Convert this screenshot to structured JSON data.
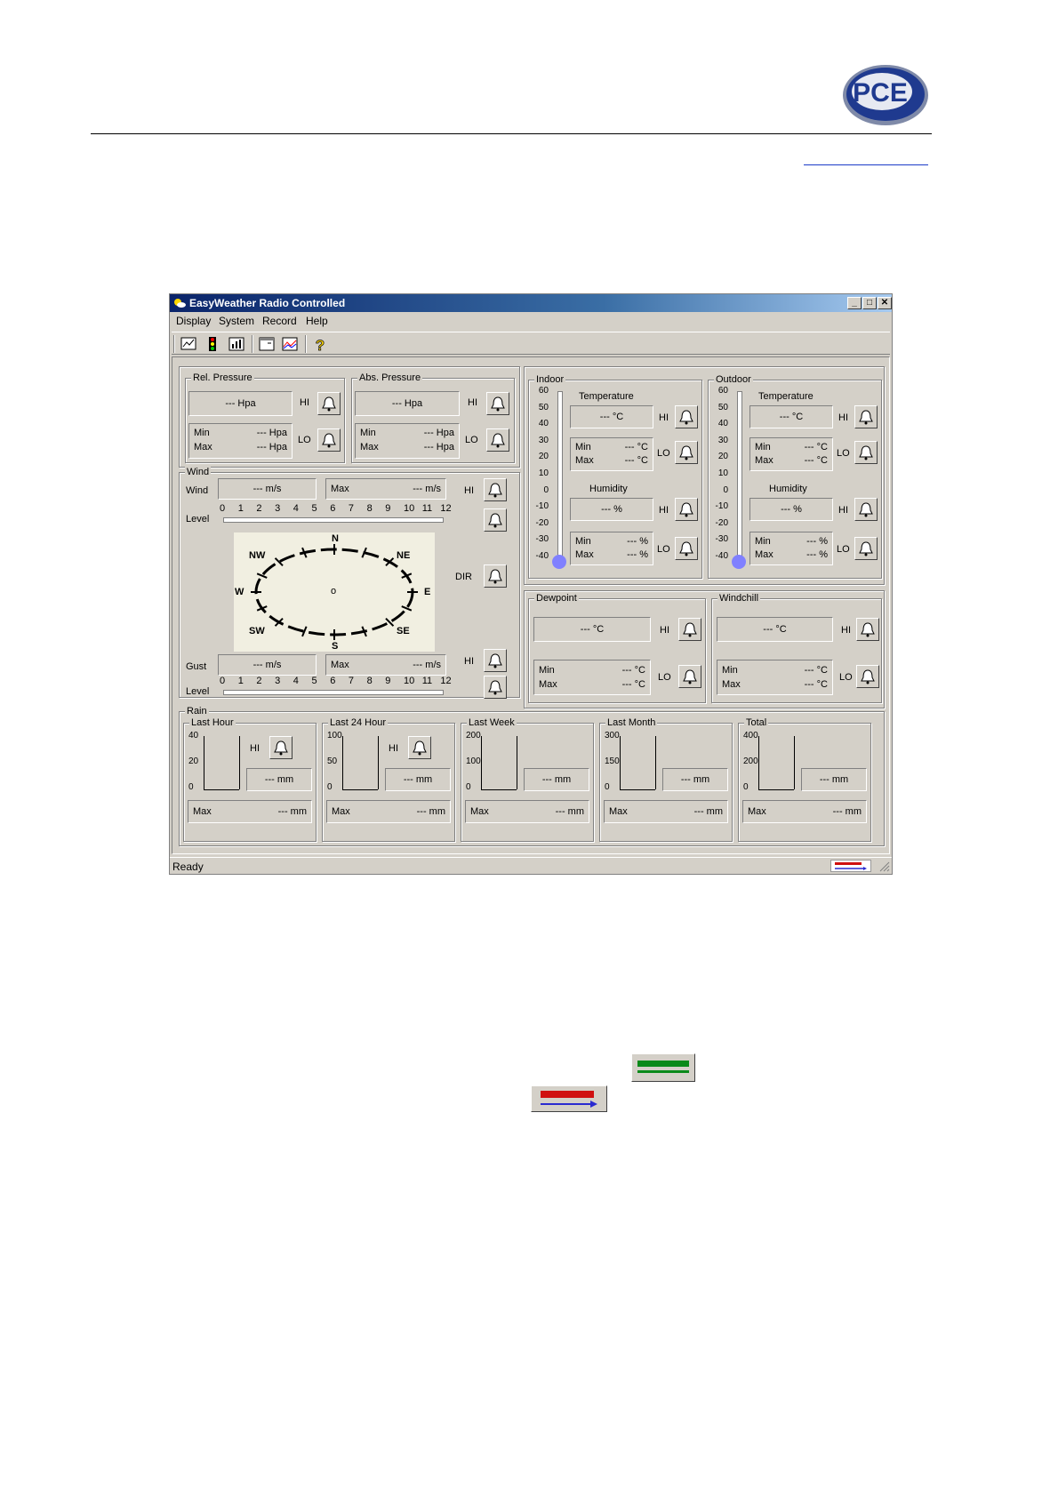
{
  "window": {
    "title": "EasyWeather Radio Controlled",
    "controls": [
      "_",
      "□",
      "✕"
    ]
  },
  "menu": [
    "Display",
    "System",
    "Record",
    "Help"
  ],
  "pressure": {
    "rel": {
      "title": "Rel. Pressure",
      "value": "--- Hpa",
      "hi": "HI",
      "lo": "LO",
      "min_label": "Min",
      "min": "--- Hpa",
      "max_label": "Max",
      "max": "--- Hpa"
    },
    "abs": {
      "title": "Abs. Pressure",
      "value": "--- Hpa",
      "hi": "HI",
      "lo": "LO",
      "min_label": "Min",
      "min": "--- Hpa",
      "max_label": "Max",
      "max": "--- Hpa"
    }
  },
  "wind": {
    "title": "Wind",
    "wind_label": "Wind",
    "wind_value": "--- m/s",
    "max_label": "Max",
    "max_value": "--- m/s",
    "hi": "HI",
    "level_label": "Level",
    "levels": [
      "0",
      "1",
      "2",
      "3",
      "4",
      "5",
      "6",
      "7",
      "8",
      "9",
      "10",
      "11",
      "12"
    ],
    "dir_label": "DIR",
    "compass": {
      "n": "N",
      "ne": "NE",
      "e": "E",
      "se": "SE",
      "s": "S",
      "sw": "SW",
      "w": "W",
      "nw": "NW",
      "center": "o"
    },
    "gust_label": "Gust",
    "gust_value": "--- m/s",
    "gust_max_label": "Max",
    "gust_max_value": "--- m/s",
    "gust_hi": "HI",
    "gust_level_label": "Level"
  },
  "thermo_scale": [
    "60",
    "50",
    "40",
    "30",
    "20",
    "10",
    "0",
    "-10",
    "-20",
    "-30",
    "-40"
  ],
  "indoor": {
    "title": "Indoor",
    "temp_label": "Temperature",
    "temp_value": "--- °C",
    "temp_hi": "HI",
    "temp_lo": "LO",
    "temp_min_label": "Min",
    "temp_min": "--- °C",
    "temp_max_label": "Max",
    "temp_max": "--- °C",
    "hum_label": "Humidity",
    "hum_value": "--- %",
    "hum_hi": "HI",
    "hum_lo": "LO",
    "hum_min_label": "Min",
    "hum_min": "--- %",
    "hum_max_label": "Max",
    "hum_max": "--- %"
  },
  "outdoor": {
    "title": "Outdoor",
    "temp_label": "Temperature",
    "temp_value": "--- °C",
    "temp_hi": "HI",
    "temp_lo": "LO",
    "temp_min_label": "Min",
    "temp_min": "--- °C",
    "temp_max_label": "Max",
    "temp_max": "--- °C",
    "hum_label": "Humidity",
    "hum_value": "--- %",
    "hum_hi": "HI",
    "hum_lo": "LO",
    "hum_min_label": "Min",
    "hum_min": "--- %",
    "hum_max_label": "Max",
    "hum_max": "--- %"
  },
  "dewpoint": {
    "title": "Dewpoint",
    "value": "--- °C",
    "hi": "HI",
    "lo": "LO",
    "min_label": "Min",
    "min": "--- °C",
    "max_label": "Max",
    "max": "--- °C"
  },
  "windchill": {
    "title": "Windchill",
    "value": "--- °C",
    "hi": "HI",
    "lo": "LO",
    "min_label": "Min",
    "min": "--- °C",
    "max_label": "Max",
    "max": "--- °C"
  },
  "rain": {
    "title": "Rain",
    "panels": [
      {
        "title": "Last Hour",
        "scale": [
          "40",
          "20",
          "0"
        ],
        "hi": "HI",
        "value": "--- mm",
        "max_label": "Max",
        "max": "--- mm"
      },
      {
        "title": "Last 24 Hour",
        "scale": [
          "100",
          "50",
          "0"
        ],
        "hi": "HI",
        "value": "--- mm",
        "max_label": "Max",
        "max": "--- mm"
      },
      {
        "title": "Last Week",
        "scale": [
          "200",
          "100",
          "0"
        ],
        "value": "--- mm",
        "max_label": "Max",
        "max": "--- mm"
      },
      {
        "title": "Last Month",
        "scale": [
          "300",
          "150",
          "0"
        ],
        "value": "--- mm",
        "max_label": "Max",
        "max": "--- mm"
      },
      {
        "title": "Total",
        "scale": [
          "400",
          "200",
          "0"
        ],
        "value": "--- mm",
        "max_label": "Max",
        "max": "--- mm"
      }
    ]
  },
  "status": {
    "text": "Ready"
  },
  "icons": {
    "logo": "pce-logo",
    "app": "weather-app-icon",
    "bell": "alarm-bell-icon",
    "connected": "connected-button-icon",
    "set_connect": "set-connect-button-icon"
  },
  "colors": {
    "titlebar": "#0a246a",
    "face": "#d4d0c8",
    "thermo_bulb": "#8080ff"
  }
}
